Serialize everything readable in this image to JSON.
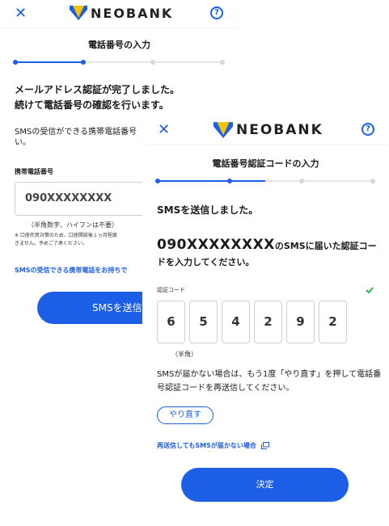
{
  "back_screen": {
    "logo_text": "NEOBANK",
    "step_title": "電話番号の入力",
    "message_line1": "メールアドレス認証が完了しました。",
    "message_line2": "続けて電話番号の確認を行います。",
    "description": "SMSの受信ができる携帯電話番号\nい。",
    "phone_label": "携帯電話番号",
    "phone_value": "090XXXXXXXX",
    "phone_hint": "（半角数字、ハイフンは不要）",
    "note": "※ 口座売買対策のため、口座開設後１ヵ月程度\nきません。予めご了承ください。",
    "link_text": "SMSの受信できる携帯電話をお持ちで",
    "submit_label": "SMSを送信"
  },
  "front_screen": {
    "logo_text": "NEOBANK",
    "step_title": "電話番号認証コードの入力",
    "sent_message": "SMSを送信しました。",
    "phone_number": "090XXXXXXXX",
    "instruction_rest": "のSMSに届いた認証コードを入力してください。",
    "code_label": "認証コード",
    "code_digits": [
      "6",
      "5",
      "4",
      "2",
      "9",
      "2"
    ],
    "halfwidth_note": "（半角）",
    "resend_description": "SMSが届かない場合は、もう1度「やり直す」を押して電話番号認証コードを再送信してください。",
    "retry_label": "やり直す",
    "help_link": "再送信してもSMSが届かない場合",
    "decide_label": "決定"
  },
  "progress": {
    "back_step_fraction": 0.33,
    "front_step_fraction": 0.5
  },
  "colors": {
    "accent": "#1c5fe6",
    "logo_yellow": "#f5c400",
    "logo_blue": "#1c5fe6",
    "check_green": "#2bb24c"
  }
}
